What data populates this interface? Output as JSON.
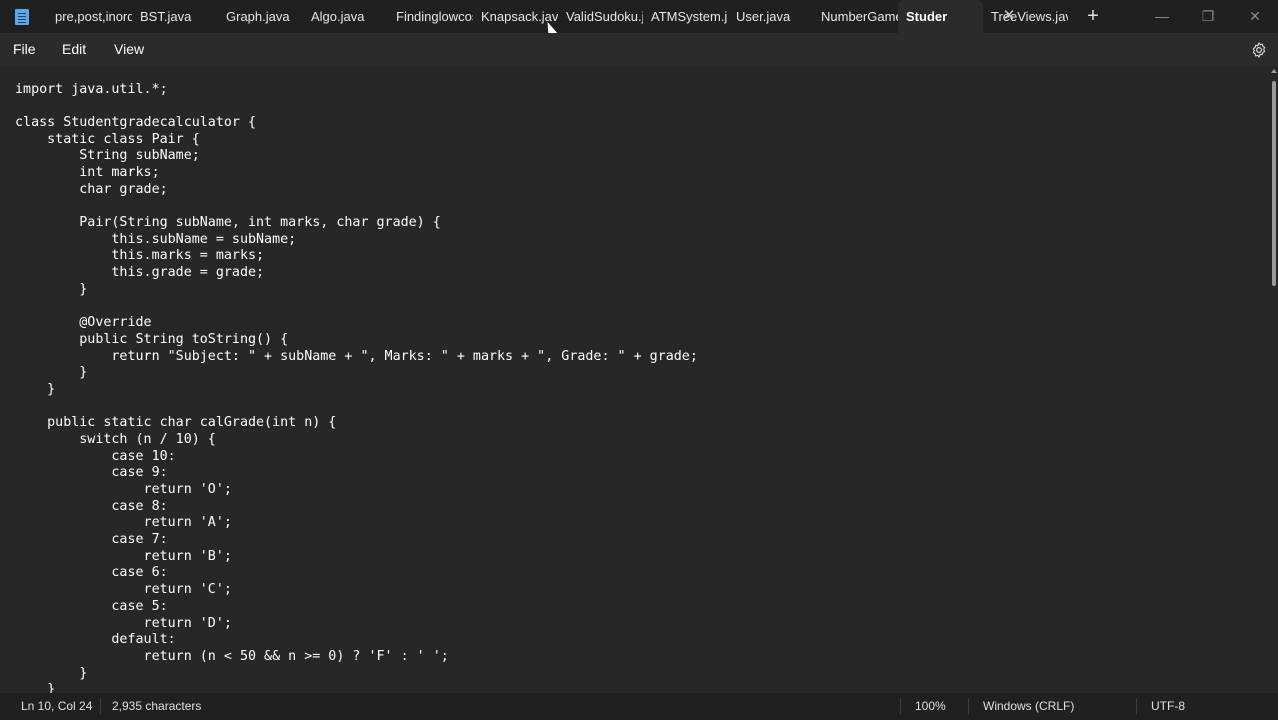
{
  "tabs": [
    {
      "label": "pre,post,inorder"
    },
    {
      "label": "BST.java"
    },
    {
      "label": "Graph.java"
    },
    {
      "label": "Algo.java"
    },
    {
      "label": "Findinglowcost"
    },
    {
      "label": "Knapsack.java"
    },
    {
      "label": "ValidSudoku.java"
    },
    {
      "label": "ATMSystem.java"
    },
    {
      "label": "User.java"
    },
    {
      "label": "NumberGame"
    },
    {
      "label": "Studer"
    },
    {
      "label": "TreeViews.java"
    }
  ],
  "active_tab_index": 10,
  "tab_close_glyph": "✕",
  "new_tab_glyph": "+",
  "window_controls": {
    "minimize": "—",
    "maximize": "❐",
    "close": "✕"
  },
  "menu": {
    "file": "File",
    "edit": "Edit",
    "view": "View"
  },
  "icons": {
    "app": "notepad-icon",
    "settings": "gear-icon"
  },
  "code_lines": [
    "import java.util.*;",
    "",
    "class Studentgradecalculator {",
    "    static class Pair {",
    "        String subName;",
    "        int marks;",
    "        char grade;",
    "",
    "        Pair(String subName, int marks, char grade) {",
    "            this.subName = subName;",
    "            this.marks = marks;",
    "            this.grade = grade;",
    "        }",
    "",
    "        @Override",
    "        public String toString() {",
    "            return \"Subject: \" + subName + \", Marks: \" + marks + \", Grade: \" + grade;",
    "        }",
    "    }",
    "",
    "    public static char calGrade(int n) {",
    "        switch (n / 10) {",
    "            case 10:",
    "            case 9:",
    "                return 'O';",
    "            case 8:",
    "                return 'A';",
    "            case 7:",
    "                return 'B';",
    "            case 6:",
    "                return 'C';",
    "            case 5:",
    "                return 'D';",
    "            default:",
    "                return (n < 50 && n >= 0) ? 'F' : ' ';",
    "        }",
    "    }"
  ],
  "status": {
    "position": "Ln 10, Col 24",
    "characters": "2,935 characters",
    "zoom": "100%",
    "line_ending": "Windows (CRLF)",
    "encoding": "UTF-8"
  },
  "colors": {
    "titlebar_bg": "#202020",
    "menubar_bg": "#2b2b2b",
    "editor_bg": "#272727",
    "text": "#ffffff"
  }
}
